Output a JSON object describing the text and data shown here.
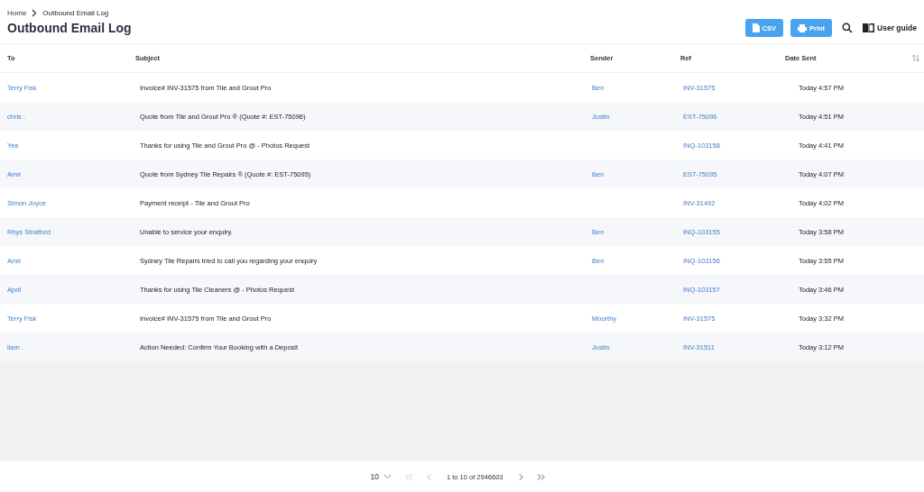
{
  "breadcrumb": {
    "home": "Home",
    "current": "Outbound Email Log"
  },
  "title": "Outbound Email Log",
  "actions": {
    "csv": "CSV",
    "print": "Print",
    "guide": "User guide"
  },
  "table": {
    "columns": [
      "To",
      "Subject",
      "Sender",
      "Ref",
      "Date Sent"
    ],
    "rows": [
      {
        "to": "Terry Fisk",
        "subject": "Invoice# INV-31575 from Tile and Grout Pro",
        "sender": "Ben",
        "ref": "INV-31575",
        "date": "Today 4:57 PM"
      },
      {
        "to": "chris .",
        "subject": "Quote from Tile and Grout Pro ® (Quote #: EST-75096)",
        "sender": "Justin",
        "ref": "EST-75096",
        "date": "Today 4:51 PM"
      },
      {
        "to": "Yee",
        "subject": "Thanks for using Tile and Grout Pro @ - Photos Request",
        "sender": "",
        "ref": "INQ-103158",
        "date": "Today 4:41 PM"
      },
      {
        "to": "Amir",
        "subject": "Quote from Sydney Tile Repairs ® (Quote #: EST-75095)",
        "sender": "Ben",
        "ref": "EST-75095",
        "date": "Today 4:07 PM"
      },
      {
        "to": "Simon Joyce",
        "subject": "Payment receipt - Tile and Grout Pro",
        "sender": "",
        "ref": "INV-31492",
        "date": "Today 4:02 PM"
      },
      {
        "to": "Rhys Stratford",
        "subject": "Unable to service your enquiry.",
        "sender": "Ben",
        "ref": "INQ-103155",
        "date": "Today 3:58 PM"
      },
      {
        "to": "Amir",
        "subject": "Sydney Tile Repairs tried to call you regarding your enquiry",
        "sender": "Ben",
        "ref": "INQ-103156",
        "date": "Today 3:55 PM"
      },
      {
        "to": "April",
        "subject": "Thanks for using Tile Cleaners @ - Photos Request",
        "sender": "",
        "ref": "INQ-103157",
        "date": "Today 3:46 PM"
      },
      {
        "to": "Terry Fisk",
        "subject": "Invoice# INV-31575 from Tile and Grout Pro",
        "sender": "Moorthy",
        "ref": "INV-31575",
        "date": "Today 3:32 PM"
      },
      {
        "to": "liam .",
        "subject": "Action Needed: Confirm Your Booking with a Deposit",
        "sender": "Justin",
        "ref": "INV-31511",
        "date": "Today 3:12 PM"
      }
    ]
  },
  "pagination": {
    "page_size": "10",
    "range": "1 to 10 of 2946603"
  }
}
